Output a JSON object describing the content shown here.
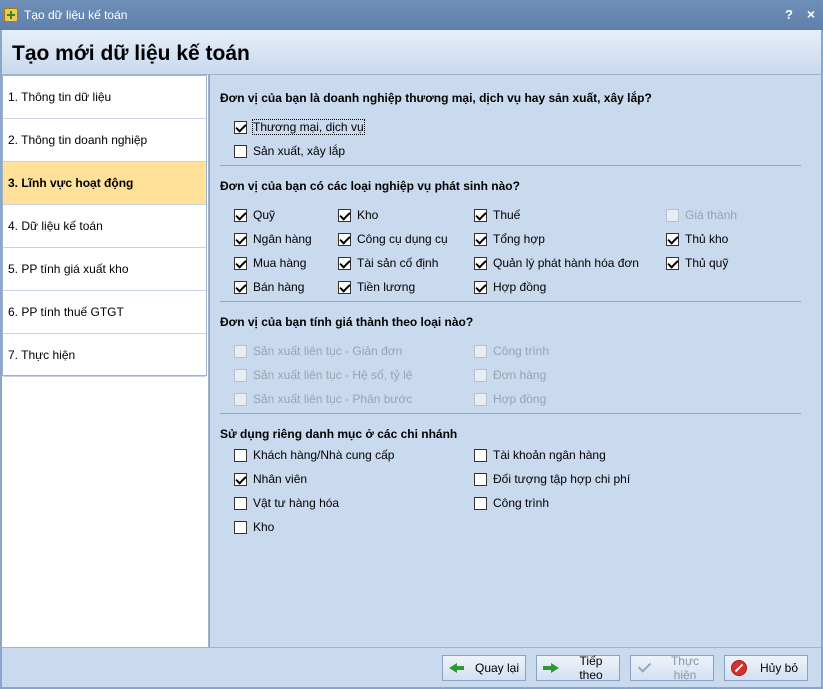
{
  "window": {
    "title": "Tạo dữ liệu kế toán",
    "help": "?",
    "close": "×"
  },
  "header": {
    "title": "Tạo mới dữ liệu kế toán"
  },
  "sidebar": {
    "items": [
      {
        "label": "1. Thông tin dữ liệu",
        "active": false
      },
      {
        "label": "2. Thông tin doanh nghiệp",
        "active": false
      },
      {
        "label": "3. Lĩnh vực hoạt động",
        "active": true
      },
      {
        "label": "4. Dữ liệu kế toán",
        "active": false
      },
      {
        "label": "5. PP tính giá xuất kho",
        "active": false
      },
      {
        "label": "6. PP tính thuế GTGT",
        "active": false
      },
      {
        "label": "7. Thực hiện",
        "active": false
      }
    ]
  },
  "sections": {
    "business_type": {
      "title": "Đơn vị của bạn là doanh nghiệp thương mại, dịch vụ hay sản xuất, xây lắp?",
      "options": [
        {
          "label": "Thương mại, dịch vụ",
          "checked": true
        },
        {
          "label": "Sản xuất, xây lắp",
          "checked": false
        }
      ]
    },
    "operations": {
      "title": "Đơn vị của bạn có các loại nghiệp vụ phát sinh nào?",
      "options": [
        {
          "label": "Quỹ",
          "checked": true
        },
        {
          "label": "Kho",
          "checked": true
        },
        {
          "label": "Thuế",
          "checked": true
        },
        {
          "label": "Giá thành",
          "checked": false,
          "disabled": true
        },
        {
          "label": "Ngân hàng",
          "checked": true
        },
        {
          "label": "Công cụ dụng cụ",
          "checked": true
        },
        {
          "label": "Tổng hợp",
          "checked": true
        },
        {
          "label": "Thủ kho",
          "checked": true
        },
        {
          "label": "Mua hàng",
          "checked": true
        },
        {
          "label": "Tài sản cố định",
          "checked": true
        },
        {
          "label": "Quản lý phát hành hóa đơn",
          "checked": true
        },
        {
          "label": "Thủ quỹ",
          "checked": true
        },
        {
          "label": "Bán hàng",
          "checked": true
        },
        {
          "label": "Tiền lương",
          "checked": true
        },
        {
          "label": "Hợp đồng",
          "checked": true
        }
      ]
    },
    "costing": {
      "title": "Đơn vị của bạn tính giá thành theo loại nào?",
      "options": [
        {
          "label": "Sản xuất liên tục - Giản đơn",
          "checked": false,
          "disabled": true
        },
        {
          "label": "Công trình",
          "checked": false,
          "disabled": true
        },
        {
          "label": "Sản xuất liên tục - Hệ số, tỷ lệ",
          "checked": false,
          "disabled": true
        },
        {
          "label": "Đơn hàng",
          "checked": false,
          "disabled": true
        },
        {
          "label": "Sản xuất liên tục - Phân bước",
          "checked": false,
          "disabled": true
        },
        {
          "label": "Hợp đồng",
          "checked": false,
          "disabled": true
        }
      ]
    },
    "branches": {
      "title": "Sử dụng riêng danh mục ở các chi nhánh",
      "options": [
        {
          "label": "Khách hàng/Nhà cung cấp",
          "checked": false
        },
        {
          "label": "Tài khoản ngân hàng",
          "checked": false
        },
        {
          "label": "Nhân viên",
          "checked": true
        },
        {
          "label": "Đối tượng tập hợp chi phí",
          "checked": false
        },
        {
          "label": "Vật tư hàng hóa",
          "checked": false
        },
        {
          "label": "Công trình",
          "checked": false
        },
        {
          "label": "Kho",
          "checked": false
        }
      ]
    }
  },
  "footer": {
    "back": "Quay lại",
    "next": "Tiếp theo",
    "finish": "Thực hiện",
    "cancel": "Hủy bỏ"
  }
}
